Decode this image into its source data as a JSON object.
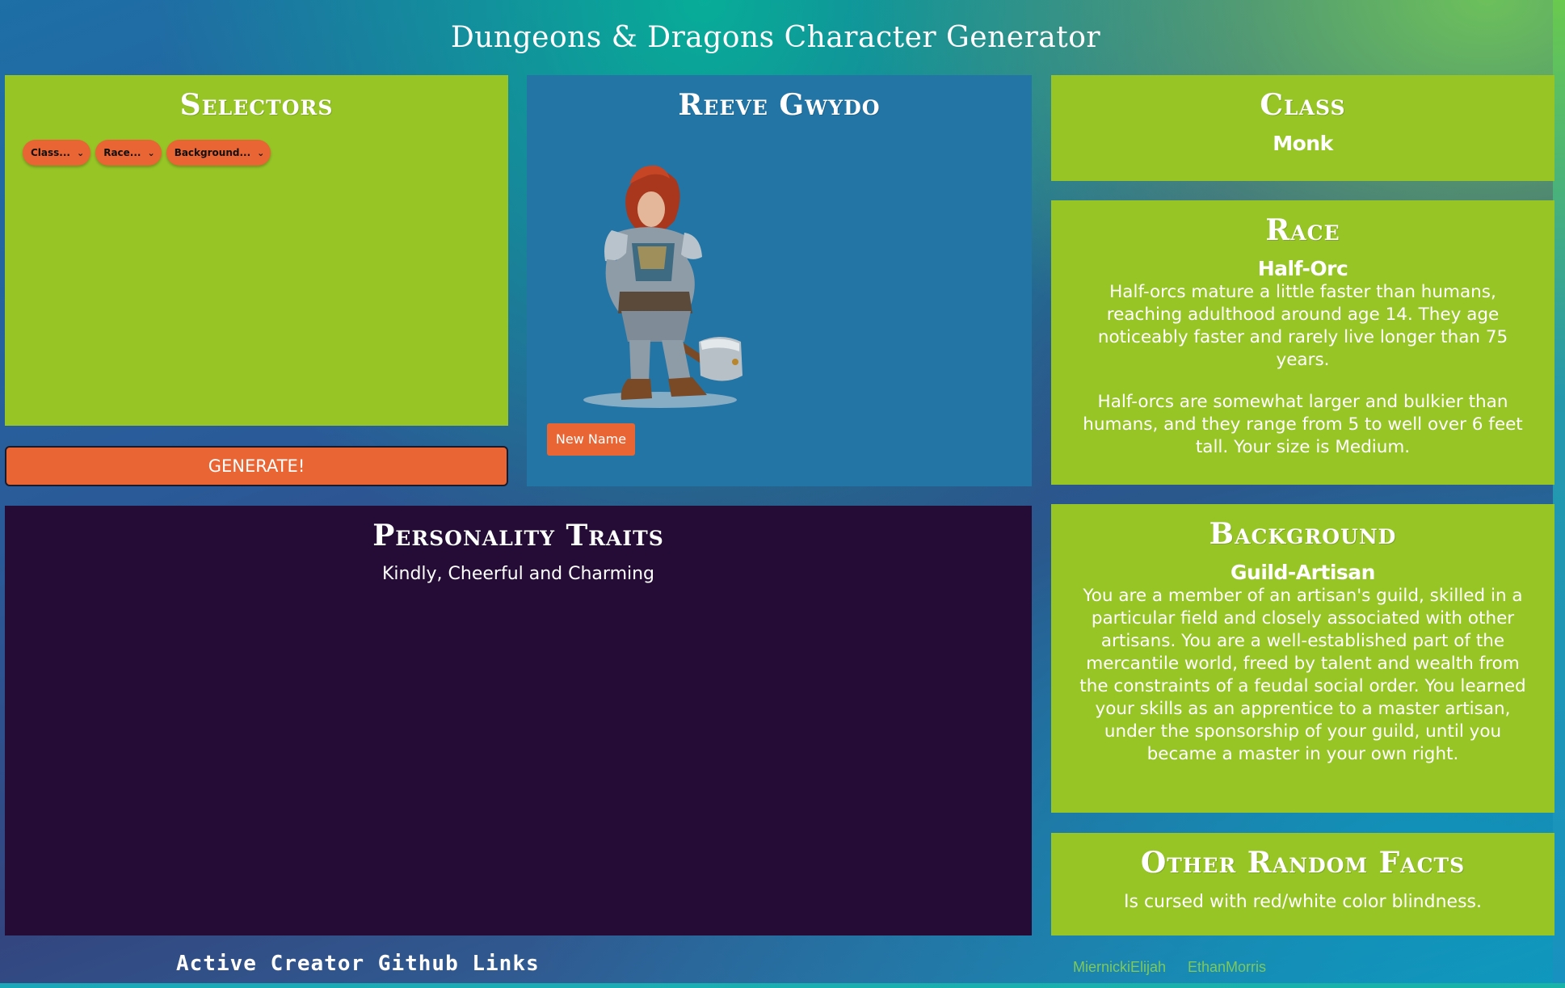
{
  "app": {
    "title": "Dungeons & Dragons Character Generator"
  },
  "selectors": {
    "heading": "Selectors",
    "class_select": "Class...",
    "race_select": "Race...",
    "background_select": "Background...",
    "generate_label": "GENERATE!"
  },
  "character": {
    "name": "Reeve Gwydo",
    "new_name_label": "New Name",
    "image_alt": "dwarf-warrior-with-warhammer"
  },
  "class": {
    "heading": "Class",
    "value": "Monk"
  },
  "race": {
    "heading": "Race",
    "value": "Half-Orc",
    "paragraph_1": "Half-orcs mature a little faster than humans, reaching adulthood around age 14. They age noticeably faster and rarely live longer than 75 years.",
    "paragraph_2": "Half-orcs are somewhat larger and bulkier than humans, and they range from 5 to well over 6 feet tall. Your size is Medium."
  },
  "personality": {
    "heading": "Personality Traits",
    "traits": "Kindly, Cheerful and Charming"
  },
  "background": {
    "heading": "Background",
    "value": "Guild-Artisan",
    "description": "You are a member of an artisan's guild, skilled in a particular field and closely associated with other artisans. You are a well-established part of the mercantile world, freed by talent and wealth from the constraints of a feudal social order. You learned your skills as an apprentice to a master artisan, under the sponsorship of your guild, until you became a master in your own right."
  },
  "facts": {
    "heading": "Other Random Facts",
    "text": "Is cursed with red/white color blindness."
  },
  "footer": {
    "title": "Active Creator Github Links",
    "links": [
      "MiernickiElijah",
      "EthanMorris"
    ]
  },
  "colors": {
    "panel_green": "#97c526",
    "panel_blue": "#2375a5",
    "panel_dark": "#250c37",
    "accent_orange": "#ea6534",
    "link_green": "#7ec95a"
  }
}
